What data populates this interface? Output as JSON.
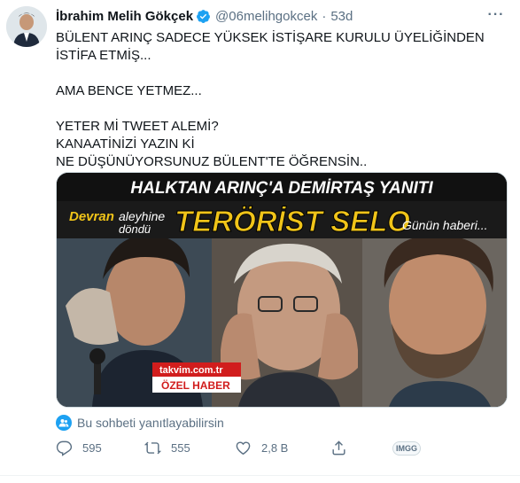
{
  "tweet": {
    "author_name": "İbrahim Melih Gökçek",
    "handle": "@06melihgokcek",
    "separator": "·",
    "time": "53d",
    "more_label": "···",
    "lines": [
      "BÜLENT ARINÇ SADECE YÜKSEK İSTİŞARE KURULU ÜYELİĞİNDEN İSTİFA ETMİŞ...",
      "",
      "AMA BENCE YETMEZ...",
      "",
      "YETER Mİ TWEET ALEMİ?",
      "KANAATİNİZİ YAZIN Kİ",
      "NE DÜŞÜNÜYORSUNUZ BÜLENT'TE ÖĞRENSİN.."
    ]
  },
  "media": {
    "headline": "HALKTAN ARINÇ'A DEMİRTAŞ YANITI",
    "left_top": "Devran",
    "left_mid": "aleyhine",
    "left_bottom": "döndü",
    "center_big": "TERÖRİST SELO",
    "right_text": "Günün haberi...",
    "logo_text": "takvim.com.tr",
    "badge_text": "ÖZEL HABER",
    "colors": {
      "headline_band": "#1a1a1a",
      "highlight": "#f0c419",
      "red": "#d11d1d"
    }
  },
  "reply_note": "Bu sohbeti yanıtlayabilirsin",
  "actions": {
    "reply_count": "595",
    "retweet_count": "555",
    "like_count": "2,8 B",
    "imgg_label": "IMGG"
  },
  "colors": {
    "accent": "#1da1f2",
    "secondary_text": "#5b7083"
  }
}
